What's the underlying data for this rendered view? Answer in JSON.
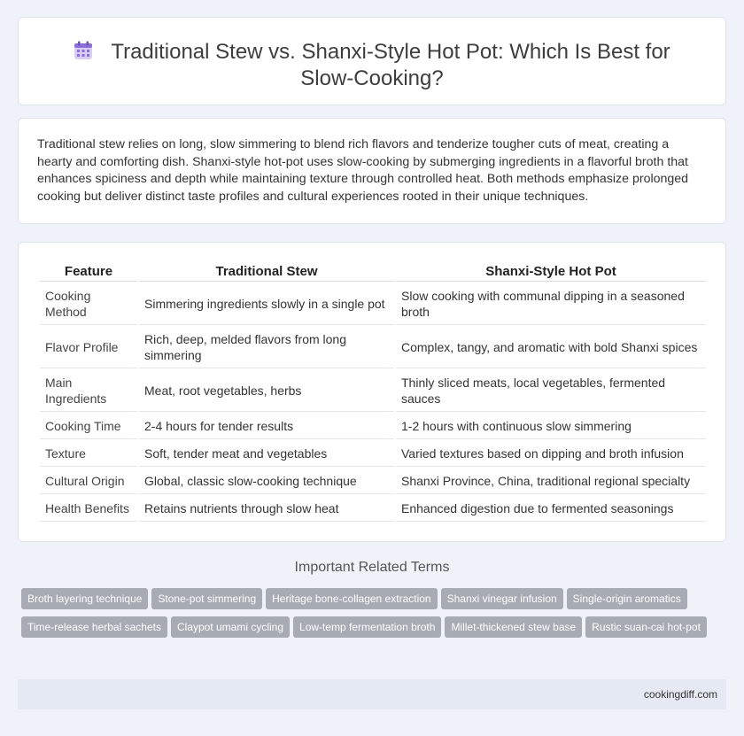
{
  "header": {
    "title": "Traditional Stew vs. Shanxi-Style Hot Pot: Which Is Best for Slow-Cooking?",
    "icon": "calendar-icon",
    "icon_color": "#8a6fd6"
  },
  "intro": {
    "text": "Traditional stew relies on long, slow simmering to blend rich flavors and tenderize tougher cuts of meat, creating a hearty and comforting dish. Shanxi-style hot-pot uses slow-cooking by submerging ingredients in a flavorful broth that enhances spiciness and depth while maintaining texture through controlled heat. Both methods emphasize prolonged cooking but deliver distinct taste profiles and cultural experiences rooted in their unique techniques."
  },
  "table": {
    "headers": [
      "Feature",
      "Traditional Stew",
      "Shanxi-Style Hot Pot"
    ],
    "rows": [
      [
        "Cooking Method",
        "Simmering ingredients slowly in a single pot",
        "Slow cooking with communal dipping in a seasoned broth"
      ],
      [
        "Flavor Profile",
        "Rich, deep, melded flavors from long simmering",
        "Complex, tangy, and aromatic with bold Shanxi spices"
      ],
      [
        "Main Ingredients",
        "Meat, root vegetables, herbs",
        "Thinly sliced meats, local vegetables, fermented sauces"
      ],
      [
        "Cooking Time",
        "2-4 hours for tender results",
        "1-2 hours with continuous slow simmering"
      ],
      [
        "Texture",
        "Soft, tender meat and vegetables",
        "Varied textures based on dipping and broth infusion"
      ],
      [
        "Cultural Origin",
        "Global, classic slow-cooking technique",
        "Shanxi Province, China, traditional regional specialty"
      ],
      [
        "Health Benefits",
        "Retains nutrients through slow heat",
        "Enhanced digestion due to fermented seasonings"
      ]
    ]
  },
  "terms": {
    "title": "Important Related Terms",
    "tags": [
      "Broth layering technique",
      "Stone-pot simmering",
      "Heritage bone-collagen extraction",
      "Shanxi vinegar infusion",
      "Single-origin aromatics",
      "Time-release herbal sachets",
      "Claypot umami cycling",
      "Low-temp fermentation broth",
      "Millet-thickened stew base",
      "Rustic suan-cai hot-pot"
    ]
  },
  "footer": {
    "site": "cookingdiff.com"
  }
}
